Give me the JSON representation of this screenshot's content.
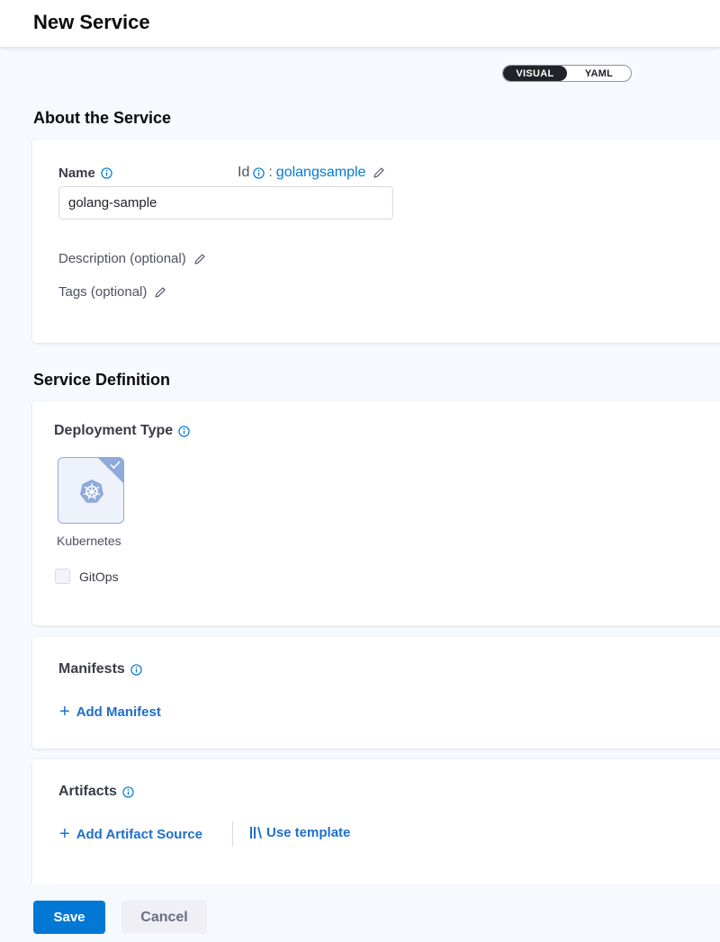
{
  "header": {
    "title": "New Service"
  },
  "view_toggle": {
    "visual_label": "VISUAL",
    "yaml_label": "YAML",
    "selected": "VISUAL"
  },
  "about": {
    "section_title": "About the Service",
    "name_label": "Name",
    "id_label": "Id",
    "id_separator": ":",
    "id_value": "golangsample",
    "name_value": "golang-sample",
    "description_label": "Description (optional)",
    "tags_label": "Tags (optional)"
  },
  "service_definition": {
    "section_title": "Service Definition",
    "deployment_type_label": "Deployment Type",
    "deployment_tile": {
      "label": "Kubernetes",
      "icon": "kubernetes-icon",
      "selected": true
    },
    "gitops_label": "GitOps",
    "gitops_checked": false
  },
  "manifests": {
    "title": "Manifests",
    "add_label": "Add Manifest"
  },
  "artifacts": {
    "title": "Artifacts",
    "add_label": "Add Artifact Source",
    "template_label": "Use template"
  },
  "footer": {
    "save_label": "Save",
    "cancel_label": "Cancel"
  },
  "colors": {
    "primary": "#0278d5",
    "link": "#1f6fc9",
    "tile_border": "#8fa9dc"
  }
}
